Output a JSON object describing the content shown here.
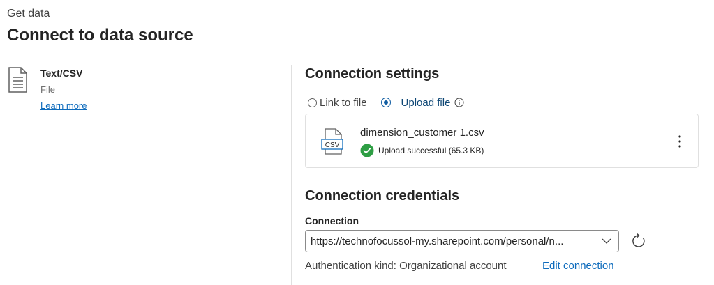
{
  "header": {
    "breadcrumb": "Get data",
    "title": "Connect to data source"
  },
  "source": {
    "name": "Text/CSV",
    "type": "File",
    "learn_more": "Learn more",
    "icon": "document-icon"
  },
  "connection_settings": {
    "title": "Connection settings",
    "options": [
      {
        "label": "Link to file",
        "selected": false
      },
      {
        "label": "Upload file",
        "selected": true
      }
    ],
    "file": {
      "icon_text": "CSV",
      "name": "dimension_customer 1.csv",
      "status": "Upload successful (65.3 KB)",
      "status_color": "#2e9e44"
    }
  },
  "connection_credentials": {
    "title": "Connection credentials",
    "connection_label": "Connection",
    "connection_value": "https://technofocussol-my.sharepoint.com/personal/n...",
    "auth_text": "Authentication kind: Organizational account",
    "edit_link": "Edit connection"
  },
  "colors": {
    "accent": "#0f6cbd",
    "selected_radio": "#115ea3"
  }
}
